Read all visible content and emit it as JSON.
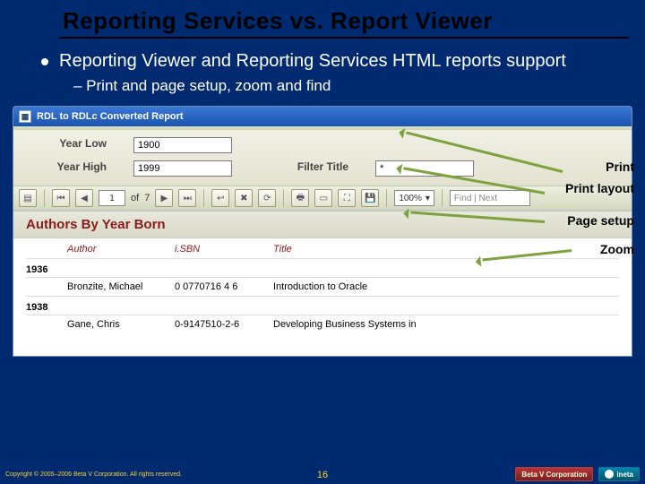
{
  "title": "Reporting Services vs. Report Viewer",
  "bullet_main": "Reporting Viewer and Reporting Services HTML reports support",
  "bullet_sub": "– Print and page setup, zoom and find",
  "window": {
    "title": "RDL to RDLc Converted Report",
    "params": {
      "year_low_label": "Year Low",
      "year_low_value": "1900",
      "year_high_label": "Year High",
      "year_high_value": "1999",
      "filter_title_label": "Filter Title",
      "filter_title_value": "*"
    },
    "toolbar": {
      "page_current": "1",
      "page_of": "of",
      "page_total": "7",
      "find_placeholder": "Find | Next",
      "zoom": "100%"
    },
    "report": {
      "title": "Authors By Year Born",
      "columns": [
        "Author",
        "i.SBN",
        "Title"
      ],
      "groups": [
        {
          "year": "1936",
          "rows": [
            {
              "author": "Bronzite, Michael",
              "isbn": "0 0770716 4 6",
              "title": "Introduction to Oracle"
            }
          ]
        },
        {
          "year": "1938",
          "rows": [
            {
              "author": "Gane, Chris",
              "isbn": "0-9147510-2-6",
              "title": "Developing Business Systems in"
            }
          ]
        }
      ]
    }
  },
  "callouts": {
    "print": "Print",
    "print_layout": "Print layout",
    "page_setup": "Page setup",
    "zoom": "Zoom"
  },
  "footer": {
    "copyright": "Copyright © 2005–2006 Beta V Corporation. All rights reserved.",
    "page": "16",
    "logo_betav": "Beta V Corporation",
    "logo_ineta": "ineta"
  }
}
